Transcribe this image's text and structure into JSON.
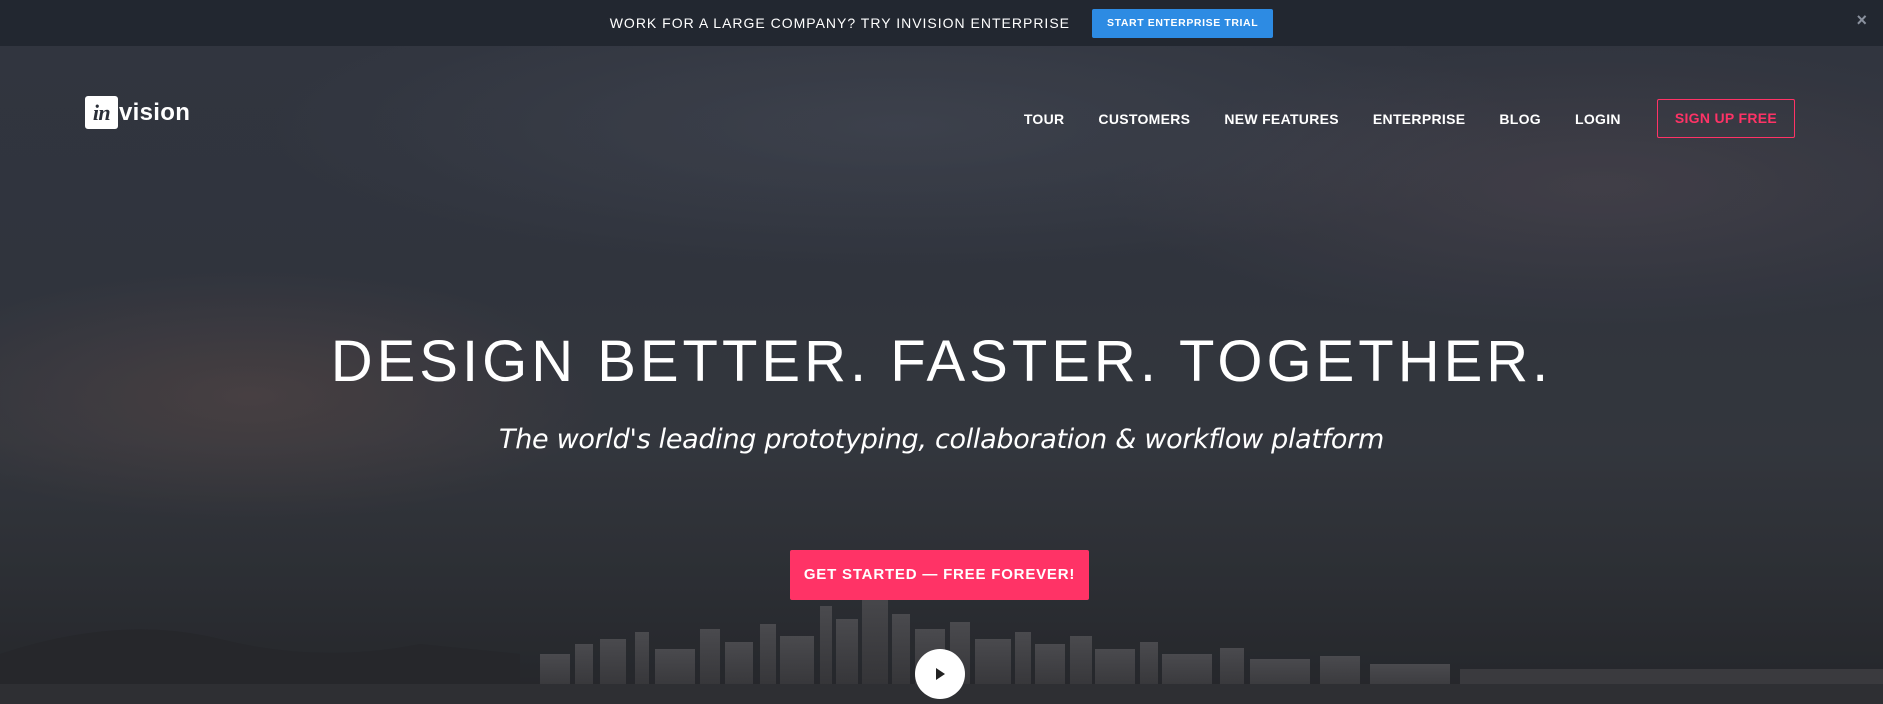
{
  "topbar": {
    "text": "WORK FOR A LARGE COMPANY? TRY INVISION ENTERPRISE",
    "button_label": "START ENTERPRISE TRIAL",
    "close_glyph": "×"
  },
  "logo": {
    "box_text": "in",
    "rest_text": "vision"
  },
  "nav": {
    "items": [
      "TOUR",
      "CUSTOMERS",
      "NEW FEATURES",
      "ENTERPRISE",
      "BLOG",
      "LOGIN"
    ],
    "signup_label": "SIGN UP FREE"
  },
  "hero": {
    "headline": "DESIGN BETTER. FASTER. TOGETHER.",
    "subhead": "The world's leading prototyping, collaboration & workflow platform",
    "cta_label": "GET STARTED — FREE FOREVER!",
    "play_icon": "play-icon"
  },
  "colors": {
    "accent_pink": "#ff3366",
    "topbar_button_blue": "#2d8be3",
    "topbar_bg": "#222730"
  }
}
